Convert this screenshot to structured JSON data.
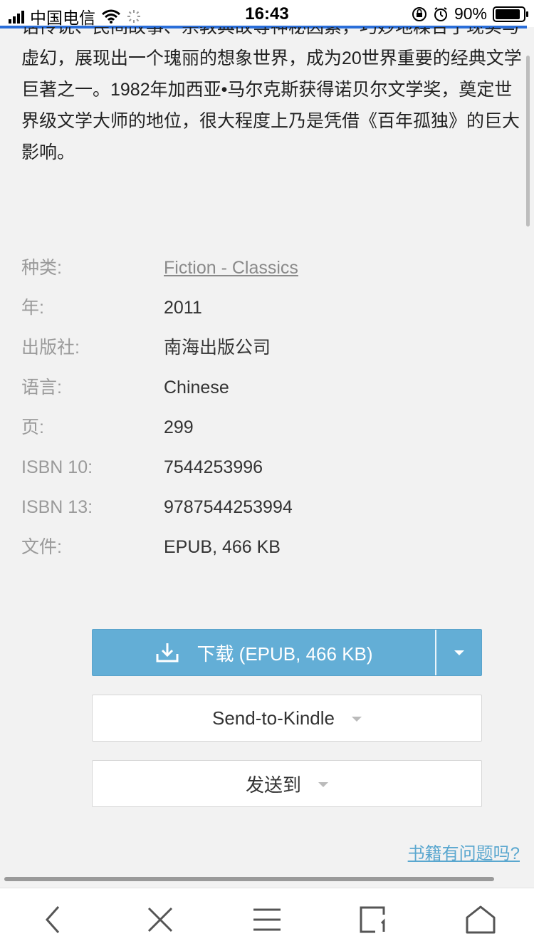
{
  "status_bar": {
    "carrier": "中国电信",
    "time": "16:43",
    "battery": "90%"
  },
  "description_lines": [
    "话传说、民间故事、宗教典故等神秘因素，巧妙地糅合了现实与",
    "虚幻，展现出一个瑰丽的想象世界，成为20世界重要的经典文学",
    "巨著之一。1982年加西亚•马尔克斯获得诺贝尔文学奖，奠定世",
    "界级文学大师的地位，很大程度上乃是凭借《百年孤独》的巨大",
    "影响。"
  ],
  "properties": [
    {
      "label": "种类:",
      "value": "Fiction - Classics",
      "link": true
    },
    {
      "label": "年:",
      "value": "2011"
    },
    {
      "label": "出版社:",
      "value": "南海出版公司"
    },
    {
      "label": "语言:",
      "value": "Chinese"
    },
    {
      "label": "页:",
      "value": "299"
    },
    {
      "label": "ISBN 10:",
      "value": "7544253996"
    },
    {
      "label": "ISBN 13:",
      "value": "9787544253994"
    },
    {
      "label": "文件:",
      "value": "EPUB, 466 KB"
    }
  ],
  "buttons": {
    "download": "下载 (EPUB, 466 KB)",
    "send_to_kindle": "Send-to-Kindle",
    "send_to": "发送到"
  },
  "problem_link": "书籍有问题吗?",
  "icons": {
    "download": "download-tray-icon",
    "back": "chevron-left-icon",
    "close": "close-icon",
    "menu": "menu-icon",
    "tabs": "tabs-icon",
    "home": "home-icon"
  },
  "colors": {
    "accent": "#63aed6",
    "link": "#5aa7cf",
    "progress": "#2a6ed9"
  }
}
